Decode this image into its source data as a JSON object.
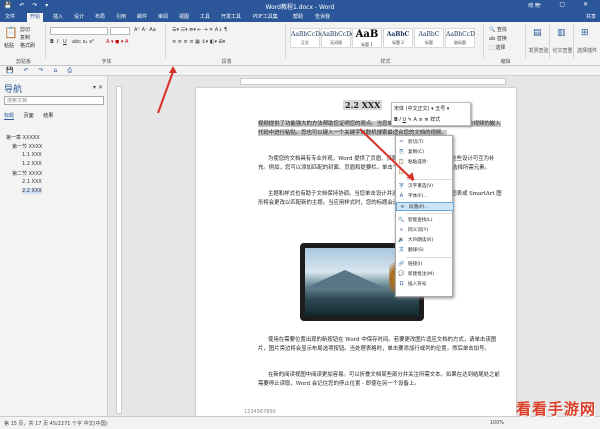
{
  "window": {
    "title": "Word教程1.docx - Word",
    "user": "晓 晓",
    "share": "共享"
  },
  "tabs": [
    "文件",
    "开始",
    "插入",
    "设计",
    "布局",
    "引用",
    "邮件",
    "审阅",
    "视图",
    "工具",
    "开发工具",
    "PDF工具集",
    "帮助"
  ],
  "tell_me": "告诉我",
  "ribbon": {
    "clipboard": {
      "paste": "粘贴",
      "cut": "剪切",
      "copy": "复制",
      "format_painter": "格式刷",
      "label": "剪贴板"
    },
    "font": {
      "label": "字体"
    },
    "paragraph": {
      "label": "段落"
    },
    "styles": {
      "label": "样式",
      "tiles": [
        {
          "sample": "AaBbCcDc",
          "name": "正文"
        },
        {
          "sample": "AaBbCcDc",
          "name": "无间隔"
        },
        {
          "sample": "AaB",
          "name": "标题 1"
        },
        {
          "sample": "AaBbC",
          "name": "标题 2"
        },
        {
          "sample": "AaBbC",
          "name": "标题"
        },
        {
          "sample": "AaBbCcD",
          "name": "副标题"
        }
      ]
    },
    "editing": {
      "find": "查找",
      "replace": "替换",
      "select": "选择",
      "label": "编辑"
    },
    "invoice": {
      "label": "发票查验"
    },
    "review": {
      "label": "论文查重"
    },
    "app": {
      "label": "选择插件"
    }
  },
  "nav": {
    "title": "导航",
    "search_placeholder": "搜索文档",
    "tabs": [
      "标题",
      "页面",
      "结果"
    ],
    "items": [
      "第一章 XXXXX",
      "第一节 XXXX",
      "1.1 XXX",
      "1.2 XXX",
      "第二节 XXXX",
      "2.1 XXX",
      "2.2 XXX"
    ]
  },
  "doc": {
    "heading": "2.2 XXX",
    "p1_hl": "视频提供了功能强大的方法帮助您证明您的观点。当您单击联机视频时，可以在想要添加的视频的嵌入代码中进行粘贴。您也可以键入一个关键字以联机搜索最适合您的文档的视频。",
    "p2": "为使您的文档具有专业外观，Word 提供了页眉、页脚、封面和文本框设计，这些设计可互为补充。例如，您可以添加匹配的封面、页眉和提要栏。单击“插入”，然后从不同库中选择所需元素。",
    "p3": "主题和样式也有助于文档保持协调。当您单击设计并选择新的主题时，图片、图表或 SmartArt 图形将会更改以匹配新的主题。当应用样式时，您的标题会进行更改以匹配新的主题。",
    "p4": "使用在需要位置出现的新按钮在 Word 中保存时间。若要更改图片适应文档的方式，请单击该图片，图片旁边将会显示布局选项按钮。当处理表格时，单击要添加行或列的位置，然后单击加号。",
    "p5": "在新的阅读视图中阅读更加容易。可以折叠文档某些部分并关注所需文本。如果在达到结尾处之前需要停止读取，Word 会记住您的停止位置 - 即使在另一个设备上。",
    "footer_text": "1234567890"
  },
  "mini_toolbar": {
    "font": "宋体 (中文正文)",
    "size": "五号",
    "styles": "样式"
  },
  "context_menu": [
    {
      "label": "剪切(T)",
      "icon": "scissors-icon"
    },
    {
      "label": "复制(C)",
      "icon": "copy-icon"
    },
    {
      "label": "粘贴选项:",
      "icon": "paste-icon"
    },
    {
      "label": "",
      "icon": "paste-keep-icon"
    },
    {
      "label": "汉字重选(V)",
      "icon": "reconvert-icon"
    },
    {
      "label": "字体(F)...",
      "icon": "font-icon"
    },
    {
      "label": "段落(P)...",
      "icon": "paragraph-icon"
    },
    {
      "label": "智能查找(L)",
      "icon": "search-icon"
    },
    {
      "label": "同义词(Y)",
      "icon": "synonym-icon"
    },
    {
      "label": "大声朗读(R)",
      "icon": "speaker-icon"
    },
    {
      "label": "翻译(S)",
      "icon": "translate-icon"
    },
    {
      "label": "链接(I)",
      "icon": "link-icon"
    },
    {
      "label": "新建批注(M)",
      "icon": "comment-icon"
    },
    {
      "label": "插入符号",
      "icon": "symbol-icon"
    }
  ],
  "status": {
    "left": "第 15 页，共 17 页   45/2271 个字   中文(中国)",
    "right": "100%"
  },
  "watermark": "看看手游网"
}
